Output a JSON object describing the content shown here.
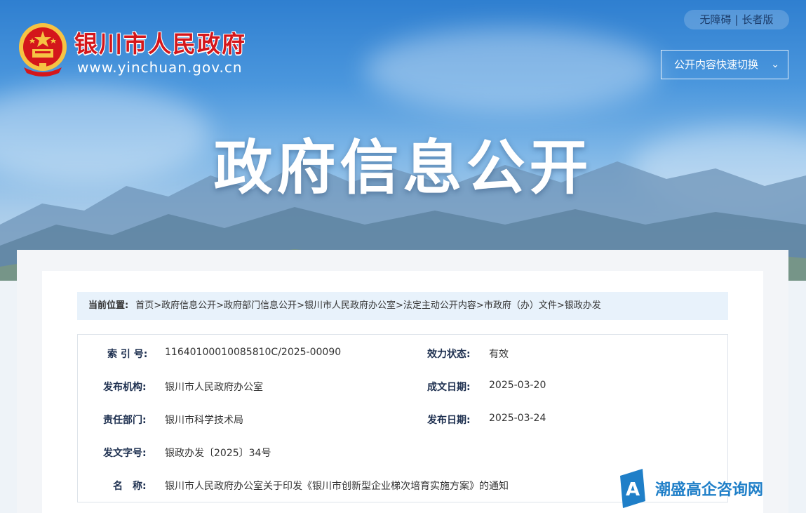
{
  "header": {
    "site_name": "银川市人民政府",
    "site_url": "www.yinchuan.gov.cn",
    "accessibility": "无障碍",
    "elder_mode": "长者版",
    "quick_switch": "公开内容快速切换",
    "hero_title": "政府信息公开"
  },
  "breadcrumb": {
    "label": "当前位置:",
    "items": [
      "首页",
      "政府信息公开",
      "政府部门信息公开",
      "银川市人民政府办公室",
      "法定主动公开内容",
      "市政府（办）文件",
      "银政办发"
    ]
  },
  "meta": {
    "index_label": "索 引 号:",
    "index_value": "11640100010085810C/2025-00090",
    "status_label": "效力状态:",
    "status_value": "有效",
    "issuer_label": "发布机构:",
    "issuer_value": "银川市人民政府办公室",
    "created_label": "成文日期:",
    "created_value": "2025-03-20",
    "dept_label": "责任部门:",
    "dept_value": "银川市科学技术局",
    "published_label": "发布日期:",
    "published_value": "2025-03-24",
    "docno_label": "发文字号:",
    "docno_value": "银政办发〔2025〕34号",
    "title_label": "名　称:",
    "title_value": "银川市人民政府办公室关于印发《银川市创新型企业梯次培育实施方案》的通知"
  },
  "watermark": {
    "text": "潮盛高企咨询网",
    "letter": "A"
  },
  "colors": {
    "site_name_red": "#d4161b",
    "label_navy": "#1d2f4f",
    "breadcrumb_bg": "#e8f2fb",
    "watermark_blue": "#1f7fc8"
  }
}
